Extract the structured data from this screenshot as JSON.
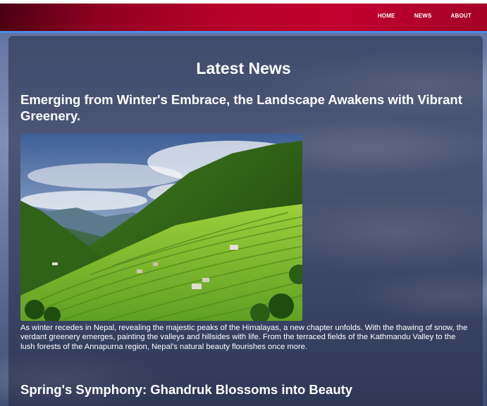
{
  "nav": {
    "items": [
      {
        "label": "HOME"
      },
      {
        "label": "NEWS"
      },
      {
        "label": "ABOUT"
      }
    ]
  },
  "colors": {
    "header": "#b5002a",
    "header_border": "#4b8de0",
    "text": "#ffffff"
  },
  "main": {
    "title": "Latest News",
    "articles": [
      {
        "title": "Emerging from Winter's Embrace, the Landscape Awakens with Vibrant Greenery.",
        "body": "As winter recedes in Nepal, revealing the majestic peaks of the Himalayas, a new chapter unfolds. With the thawing of snow, the verdant greenery emerges, painting the valleys and hillsides with life. From the terraced fields of the Kathmandu Valley to the lush forests of the Annapurna region, Nepal's natural beauty flourishes once more."
      },
      {
        "title": "Spring's Symphony: Ghandruk Blossoms into Beauty"
      }
    ]
  }
}
